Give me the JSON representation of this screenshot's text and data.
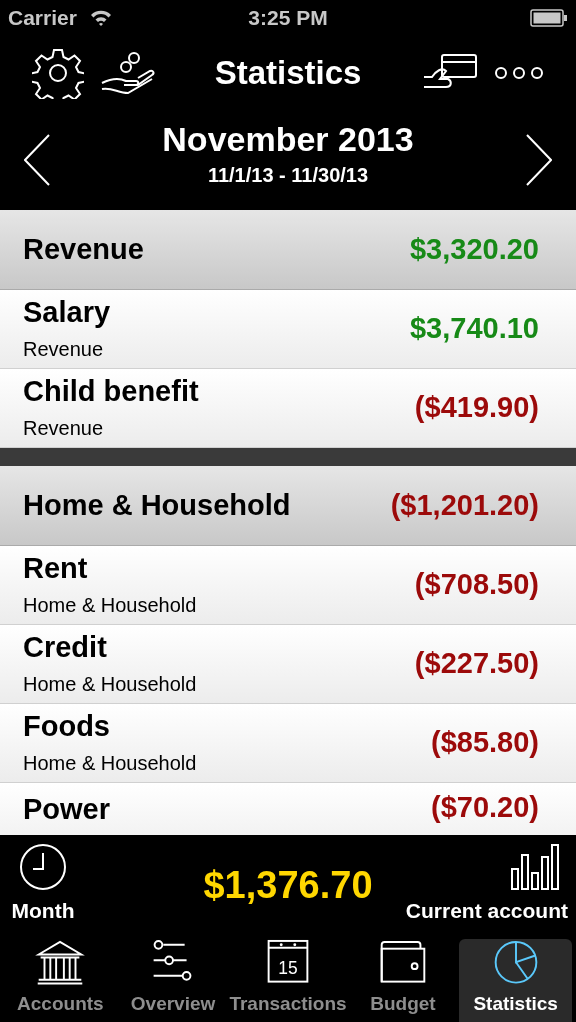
{
  "status_bar": {
    "carrier": "Carrier",
    "time": "3:25 PM"
  },
  "nav": {
    "title": "Statistics"
  },
  "period": {
    "title": "November 2013",
    "range": "11/1/13 - 11/30/13"
  },
  "groups": [
    {
      "name": "Revenue",
      "total": "$3,320.20",
      "kind": "income",
      "items": [
        {
          "name": "Salary",
          "category": "Revenue",
          "amount": "$3,740.10",
          "kind": "income"
        },
        {
          "name": "Child benefit",
          "category": "Revenue",
          "amount": "($419.90)",
          "kind": "expense"
        }
      ]
    },
    {
      "name": "Home & Household",
      "total": "($1,201.20)",
      "kind": "expense",
      "items": [
        {
          "name": "Rent",
          "category": "Home & Household",
          "amount": "($708.50)",
          "kind": "expense"
        },
        {
          "name": "Credit",
          "category": "Home & Household",
          "amount": "($227.50)",
          "kind": "expense"
        },
        {
          "name": "Foods",
          "category": "Home & Household",
          "amount": "($85.80)",
          "kind": "expense"
        },
        {
          "name": "Power",
          "amount": "($70.20)",
          "kind": "expense"
        }
      ]
    }
  ],
  "summary": {
    "period_label": "Month",
    "balance": "$1,376.70",
    "account_label": "Current account"
  },
  "tabs": [
    {
      "label": "Accounts",
      "kind": "bank",
      "selected": false
    },
    {
      "label": "Overview",
      "kind": "sliders",
      "selected": false
    },
    {
      "label": "Transactions",
      "kind": "calendar",
      "icon_text": "15",
      "selected": false
    },
    {
      "label": "Budget",
      "kind": "wallet",
      "selected": false
    },
    {
      "label": "Statistics",
      "kind": "pie",
      "selected": true
    }
  ]
}
